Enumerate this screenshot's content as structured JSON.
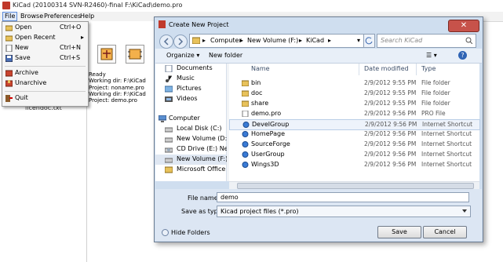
{
  "app": {
    "title": "KiCad (20100314 SVN-R2460)-final F:\\KiCad\\demo.pro",
    "menu": [
      "File",
      "Browse",
      "Preferences",
      "Help"
    ]
  },
  "file_menu": {
    "items": [
      {
        "label": "Open",
        "shortcut": "Ctrl+O",
        "icon": "open-icon"
      },
      {
        "label": "Open Recent",
        "shortcut": "",
        "icon": "open-recent-icon",
        "submenu": true
      },
      {
        "label": "New",
        "shortcut": "Ctrl+N",
        "icon": "new-icon"
      },
      {
        "label": "Save",
        "shortcut": "Ctrl+S",
        "icon": "save-icon"
      },
      {
        "label": "Archive",
        "shortcut": "",
        "icon": "archive-icon"
      },
      {
        "label": "Unarchive",
        "shortcut": "",
        "icon": "unarchive-icon"
      },
      {
        "label": "Quit",
        "shortcut": "",
        "icon": "quit-icon"
      }
    ]
  },
  "status": {
    "lines": [
      "Ready",
      "Working dir: F:\\KiCad",
      "Project: noname.pro",
      "Working dir: F:\\KiCad",
      "Project: demo.pro"
    ],
    "tree_item": "licendoc.txt"
  },
  "dialog": {
    "title": "Create New Project",
    "path": [
      "Computer",
      "New Volume (F:)",
      "KiCad"
    ],
    "search_placeholder": "Search KiCad",
    "organize": "Organize",
    "new_folder": "New folder",
    "nav": [
      {
        "label": "Documents",
        "icon": "documents-icon"
      },
      {
        "label": "Music",
        "icon": "music-icon"
      },
      {
        "label": "Pictures",
        "icon": "pictures-icon"
      },
      {
        "label": "Videos",
        "icon": "videos-icon"
      },
      {
        "label": "Computer",
        "icon": "computer-icon"
      },
      {
        "label": "Local Disk (C:)",
        "icon": "drive-icon"
      },
      {
        "label": "New Volume (D:)",
        "icon": "drive-icon"
      },
      {
        "label": "CD Drive (E:) Nee",
        "icon": "cd-drive-icon"
      },
      {
        "label": "New Volume (F:)",
        "icon": "drive-icon"
      },
      {
        "label": "Microsoft Office",
        "icon": "office-icon"
      }
    ],
    "columns": [
      "Name",
      "Date modified",
      "Type"
    ],
    "files": [
      {
        "name": "bin",
        "date": "2/9/2012 9:55 PM",
        "type": "File folder",
        "icon": "folder-icon"
      },
      {
        "name": "doc",
        "date": "2/9/2012 9:55 PM",
        "type": "File folder",
        "icon": "folder-icon"
      },
      {
        "name": "share",
        "date": "2/9/2012 9:55 PM",
        "type": "File folder",
        "icon": "folder-icon"
      },
      {
        "name": "demo.pro",
        "date": "2/9/2012 9:56 PM",
        "type": "PRO File",
        "icon": "file-icon"
      },
      {
        "name": "DevelGroup",
        "date": "2/9/2012 9:56 PM",
        "type": "Internet Shortcut",
        "icon": "shortcut-icon"
      },
      {
        "name": "HomePage",
        "date": "2/9/2012 9:56 PM",
        "type": "Internet Shortcut",
        "icon": "shortcut-icon"
      },
      {
        "name": "SourceForge",
        "date": "2/9/2012 9:56 PM",
        "type": "Internet Shortcut",
        "icon": "shortcut-icon"
      },
      {
        "name": "UserGroup",
        "date": "2/9/2012 9:56 PM",
        "type": "Internet Shortcut",
        "icon": "shortcut-icon"
      },
      {
        "name": "Wings3D",
        "date": "2/9/2012 9:56 PM",
        "type": "Internet Shortcut",
        "icon": "shortcut-icon"
      }
    ],
    "file_name_label": "File name:",
    "file_name_value": "demo",
    "save_type_label": "Save as type:",
    "save_type_value": "Kicad project files (*.pro)",
    "hide_folders": "Hide Folders",
    "save": "Save",
    "cancel": "Cancel"
  },
  "colors": {
    "accent": "#dfe9f8",
    "dialog_bg": "#cfdeef",
    "folder": "#e8c25b",
    "shortcut": "#3a7bd5"
  }
}
